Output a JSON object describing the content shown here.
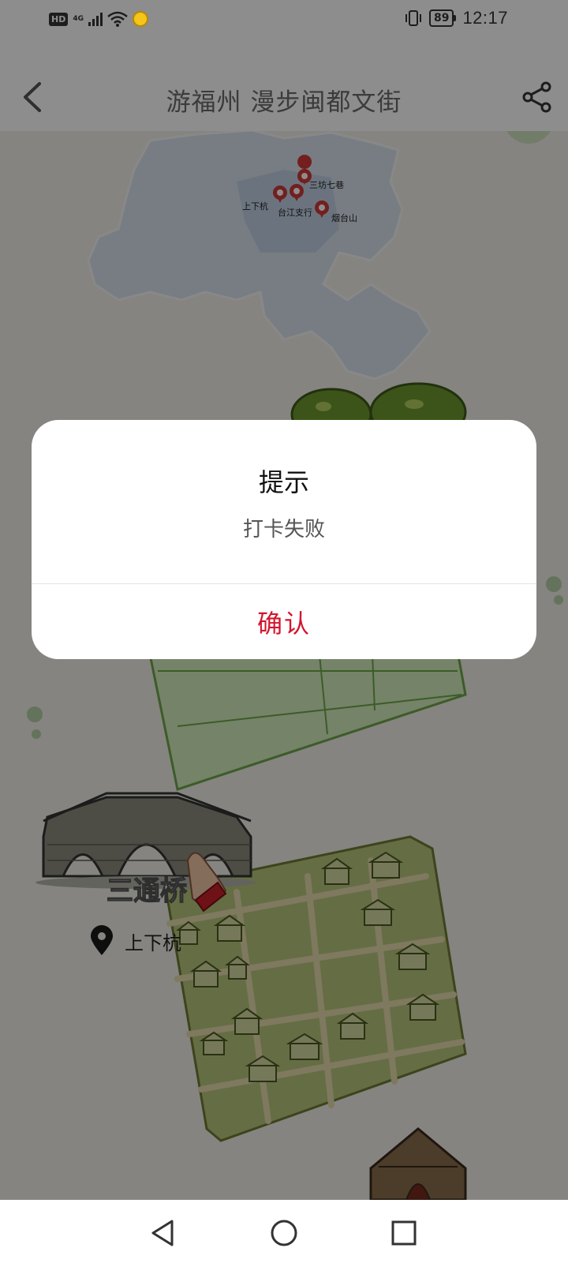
{
  "status_bar": {
    "hd": "HD",
    "network": "4G",
    "battery": "89",
    "time": "12:17",
    "icons": [
      "signal-icon",
      "wifi-icon",
      "coin-icon",
      "vibrate-icon",
      "battery-icon"
    ]
  },
  "header": {
    "title": "游福州 漫步闽都文街",
    "back_icon": "chevron-left-icon",
    "share_icon": "share-icon"
  },
  "map": {
    "pins": [
      {
        "label": "三坊七巷"
      },
      {
        "label": "上下杭"
      },
      {
        "label": "台江支行"
      },
      {
        "label": "烟台山"
      }
    ],
    "pin_color": "#d13a3a",
    "region_color": "#c9d6e6"
  },
  "spot": {
    "name": "三通桥",
    "location": "上下杭",
    "location_icon": "map-pin-icon"
  },
  "dialog": {
    "title": "提示",
    "message": "打卡失败",
    "confirm_label": "确认",
    "accent_color": "#d4152d"
  },
  "nav_bar": {
    "icons": [
      "back-triangle-icon",
      "home-circle-icon",
      "recents-square-icon"
    ]
  }
}
